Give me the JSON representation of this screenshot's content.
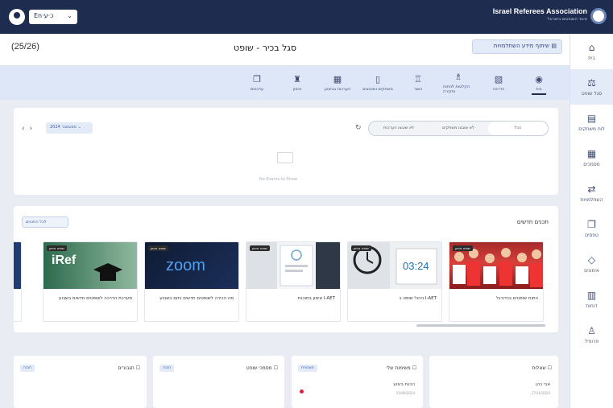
{
  "topbar": {
    "lang_label": "En·כ·ע",
    "brand_title": "Israel Referees Association",
    "brand_subtitle": "איגוד השופטים בישראל"
  },
  "sidebar": {
    "items": [
      {
        "icon": "home-icon",
        "glyph": "⌂",
        "label": "בית"
      },
      {
        "icon": "referee-icon",
        "glyph": "⚖",
        "label": "סגל שופט"
      },
      {
        "icon": "calendar-icon",
        "glyph": "▤",
        "label": "לוח משחקים"
      },
      {
        "icon": "document-icon",
        "glyph": "▦",
        "label": "מסמכים"
      },
      {
        "icon": "training-icon",
        "glyph": "⇄",
        "label": "השתלמויות"
      },
      {
        "icon": "files-icon",
        "glyph": "❐",
        "label": "טפסים"
      },
      {
        "icon": "location-icon",
        "glyph": "◇",
        "label": "אימונים"
      },
      {
        "icon": "table-icon",
        "glyph": "▥",
        "label": "דוחות"
      },
      {
        "icon": "person-icon",
        "glyph": "♙",
        "label": "פרופיל"
      }
    ],
    "active_index": 1
  },
  "header": {
    "counter": "(25/26)",
    "title": "סגל בכיר - שופט",
    "print_label": "שיתוף מידע השתלמויות"
  },
  "tabs": [
    {
      "glyph": "❐",
      "label": "עדכונים"
    },
    {
      "glyph": "♜",
      "label": "אימון"
    },
    {
      "glyph": "▦",
      "label": "הערכות בביצוע"
    },
    {
      "glyph": "▯",
      "label": "משחקים ושיבוצים"
    },
    {
      "glyph": "♖",
      "label": "כושר"
    },
    {
      "glyph": "♗",
      "label": "הקלטות לניתוח וחקירה"
    },
    {
      "glyph": "▧",
      "label": "הדרכה"
    },
    {
      "glyph": "◉",
      "label": "בית"
    }
  ],
  "panel_a": {
    "month_label": "ספטמבר 2024 ⌄",
    "filter_options": [
      "הכל",
      "לא שובצו משחקים",
      "לא שובצו הערכות"
    ],
    "empty_text": "No Events to Show"
  },
  "news": {
    "title": "תכנים חדשים",
    "all_button": "לכל התכנים",
    "cards": [
      {
        "caption": "ניתוח שופטים בכדורגל",
        "thumb": "stadium-crowd"
      },
      {
        "caption": "ניהול שופט ב I-AET",
        "thumb": "clock-0324",
        "time": "03:24"
      },
      {
        "caption": "אימון בתוכנת I-AET",
        "thumb": "app-screen"
      },
      {
        "caption": "מה הכירה לשופטים חדשים בזום בשבוע",
        "thumb": "zoom",
        "brand": "zoom"
      },
      {
        "caption": "מערכת הדרכה לשופטים חדשים בשבוע",
        "thumb": "iref",
        "brand": "iRef"
      }
    ],
    "card_tag": "שופט אימון"
  },
  "widgets": [
    {
      "title": "שאלות ☐",
      "tag": "",
      "lines": [
        "אבי כהן",
        "27/10/2025"
      ]
    },
    {
      "title": "משימות שלי ☐",
      "tag": "חשבונית",
      "lines": [
        "הכנת ביצוע",
        "25/09/2024"
      ]
    },
    {
      "title": "מסמכי שופט ☐",
      "tag": "הכנה",
      "lines": []
    },
    {
      "title": "תגבורים ☐",
      "tag": "הכנה",
      "lines": []
    }
  ],
  "colors": {
    "brand_navy": "#1d2c4f",
    "accent_blue": "#3a5aa6",
    "tab_bg": "#dde7f7",
    "alert_red": "#d9233b"
  }
}
